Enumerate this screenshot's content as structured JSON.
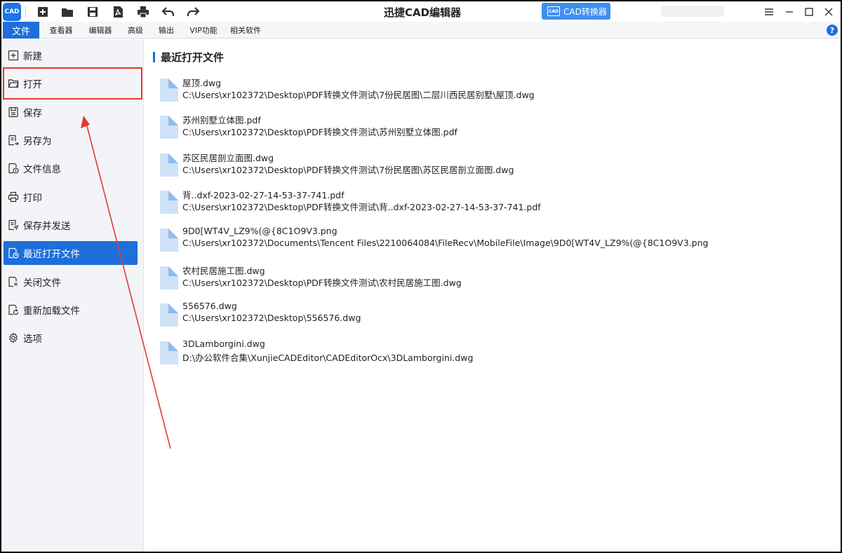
{
  "window": {
    "title": "迅捷CAD编辑器",
    "logo_text": "CAD",
    "converter_button": {
      "icon_text": "CAD",
      "label": "CAD转换器"
    }
  },
  "quick_access": [
    "new-file-icon",
    "open-folder-icon",
    "save-disk-icon",
    "pdf-export-icon",
    "print-icon",
    "undo-icon",
    "redo-icon"
  ],
  "menu": {
    "tabs": [
      {
        "label": "文件",
        "active": true
      },
      {
        "label": "查看器",
        "active": false
      },
      {
        "label": "编辑器",
        "active": false
      },
      {
        "label": "高级",
        "active": false
      },
      {
        "label": "输出",
        "active": false
      },
      {
        "label": "VIP功能",
        "active": false
      },
      {
        "label": "相关软件",
        "active": false
      }
    ],
    "help_label": "?"
  },
  "sidebar": {
    "items": [
      {
        "label": "新建",
        "icon": "new-icon"
      },
      {
        "label": "打开",
        "icon": "open-icon"
      },
      {
        "label": "保存",
        "icon": "save-icon"
      },
      {
        "label": "另存为",
        "icon": "save-as-icon"
      },
      {
        "label": "文件信息",
        "icon": "file-info-icon"
      },
      {
        "label": "打印",
        "icon": "print-icon"
      },
      {
        "label": "保存并发送",
        "icon": "save-send-icon"
      },
      {
        "label": "最近打开文件",
        "icon": "recent-files-icon",
        "active": true
      },
      {
        "label": "关闭文件",
        "icon": "close-file-icon"
      },
      {
        "label": "重新加载文件",
        "icon": "reload-file-icon"
      },
      {
        "label": "选项",
        "icon": "gear-icon"
      }
    ]
  },
  "recent": {
    "title": "最近打开文件",
    "files": [
      {
        "name": "屋顶.dwg",
        "path": "C:\\Users\\xr102372\\Desktop\\PDF转换文件测试\\7份民居图\\二层川西民居别墅\\屋顶.dwg"
      },
      {
        "name": "苏州别墅立体图.pdf",
        "path": "C:\\Users\\xr102372\\Desktop\\PDF转换文件测试\\苏州别墅立体图.pdf"
      },
      {
        "name": "苏区民居剖立面图.dwg",
        "path": "C:\\Users\\xr102372\\Desktop\\PDF转换文件测试\\7份民居图\\苏区民居剖立面图.dwg"
      },
      {
        "name": "背..dxf-2023-02-27-14-53-37-741.pdf",
        "path": "C:\\Users\\xr102372\\Desktop\\PDF转换文件测试\\背..dxf-2023-02-27-14-53-37-741.pdf"
      },
      {
        "name": "9D0[WT4V_LZ9%(@{8C1O9V3.png",
        "path": "C:\\Users\\xr102372\\Documents\\Tencent Files\\2210064084\\FileRecv\\MobileFile\\Image\\9D0[WT4V_LZ9%(@{8C1O9V3.png"
      },
      {
        "name": "农村民居施工图.dwg",
        "path": "C:\\Users\\xr102372\\Desktop\\PDF转换文件测试\\农村民居施工图.dwg"
      },
      {
        "name": "556576.dwg",
        "path": "C:\\Users\\xr102372\\Desktop\\556576.dwg"
      },
      {
        "name": "3DLamborgini.dwg",
        "path": "D:\\办公软件合集\\XunjieCADEditor\\CADEditorOcx\\3DLamborgini.dwg"
      }
    ]
  },
  "colors": {
    "accent": "#1e6fd9",
    "annotation": "#e53935",
    "file_icon": "#cfe2f8"
  }
}
